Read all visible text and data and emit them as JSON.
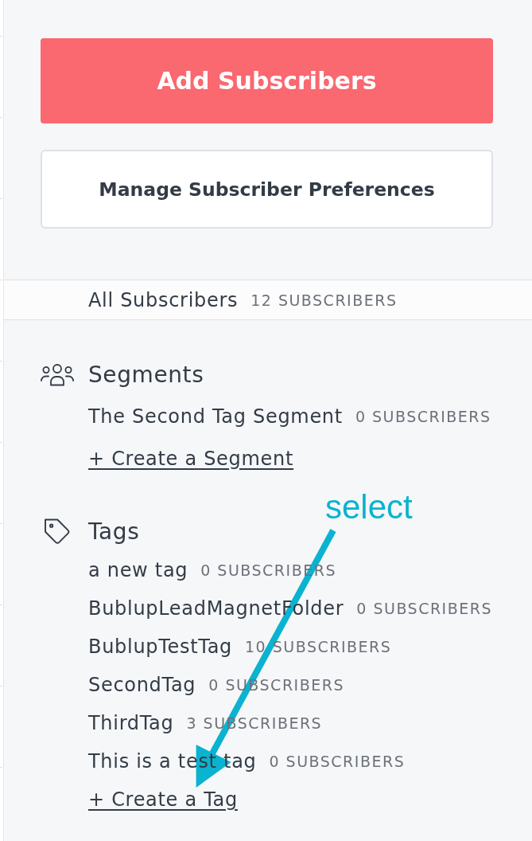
{
  "buttons": [
    {
      "label": "Add Subscribers",
      "kind": "primary"
    },
    {
      "label": "Manage Subscriber Preferences",
      "kind": "secondary"
    }
  ],
  "all_subscribers": {
    "name": "All Subscribers",
    "count": "12 SUBSCRIBERS",
    "selected": true
  },
  "sections": [
    {
      "kind": "segments",
      "title": "Segments",
      "items": [
        {
          "name": "The Second Tag Segment",
          "count": "0 SUBSCRIBERS",
          "selected": false
        }
      ],
      "create_link": "+ Create a Segment"
    },
    {
      "kind": "tags",
      "title": "Tags",
      "items": [
        {
          "name": "a new tag",
          "count": "0 SUBSCRIBERS",
          "selected": false
        },
        {
          "name": "BublupLeadMagnetFolder",
          "count": "0 SUBSCRIBERS",
          "selected": false
        },
        {
          "name": "BublupTestTag",
          "count": "10 SUBSCRIBERS",
          "selected": false
        },
        {
          "name": "SecondTag",
          "count": "0 SUBSCRIBERS",
          "selected": false
        },
        {
          "name": "ThirdTag",
          "count": "3 SUBSCRIBERS",
          "selected": false
        },
        {
          "name": "This is a test tag",
          "count": "0 SUBSCRIBERS",
          "selected": false
        }
      ],
      "create_link": "+ Create a Tag"
    }
  ],
  "annotation": {
    "label": "select"
  }
}
